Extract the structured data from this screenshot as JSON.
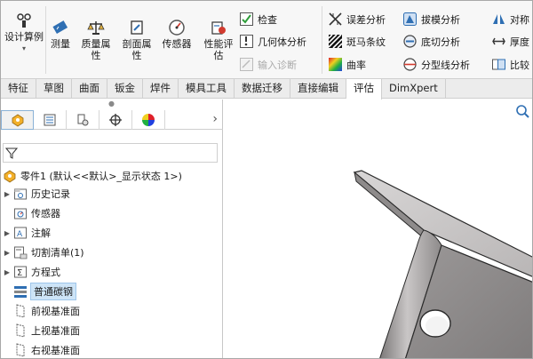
{
  "ribbon": {
    "design_study": "设计算例",
    "measure": "测量",
    "mass_properties": "质量属性",
    "section_properties": "剖面属性",
    "sensor": "传感器",
    "performance_eval": "性能评估",
    "check": "检查",
    "geometry_analysis": "几何体分析",
    "import_diagnostics": "输入诊断",
    "deviation_analysis": "误差分析",
    "zebra_stripes": "斑马条纹",
    "curvature": "曲率",
    "draft_analysis": "拔模分析",
    "undercut_analysis": "底切分析",
    "parting_line_analysis": "分型线分析",
    "symmetry_check": "对称",
    "thickness_analysis": "厚度",
    "compare": "比较"
  },
  "tabs": [
    "特征",
    "草图",
    "曲面",
    "钣金",
    "焊件",
    "模具工具",
    "数据迁移",
    "直接编辑",
    "评估",
    "DimXpert"
  ],
  "active_tab": "评估",
  "tree": {
    "root": "零件1 (默认<<默认>_显示状态 1>)",
    "items": [
      {
        "label": "历史记录",
        "expand": true
      },
      {
        "label": "传感器",
        "expand": false
      },
      {
        "label": "注解",
        "expand": true
      },
      {
        "label": "切割清单(1)",
        "expand": true
      },
      {
        "label": "方程式",
        "expand": true
      },
      {
        "label": "普通碳钢",
        "expand": false,
        "selected": true
      },
      {
        "label": "前视基准面",
        "expand": false
      },
      {
        "label": "上视基准面",
        "expand": false
      },
      {
        "label": "右视基准面",
        "expand": false
      }
    ]
  },
  "colors": {
    "accent_blue": "#2f6fb3",
    "selection": "#cde4f7",
    "part_gray": "#8f8c8c"
  }
}
